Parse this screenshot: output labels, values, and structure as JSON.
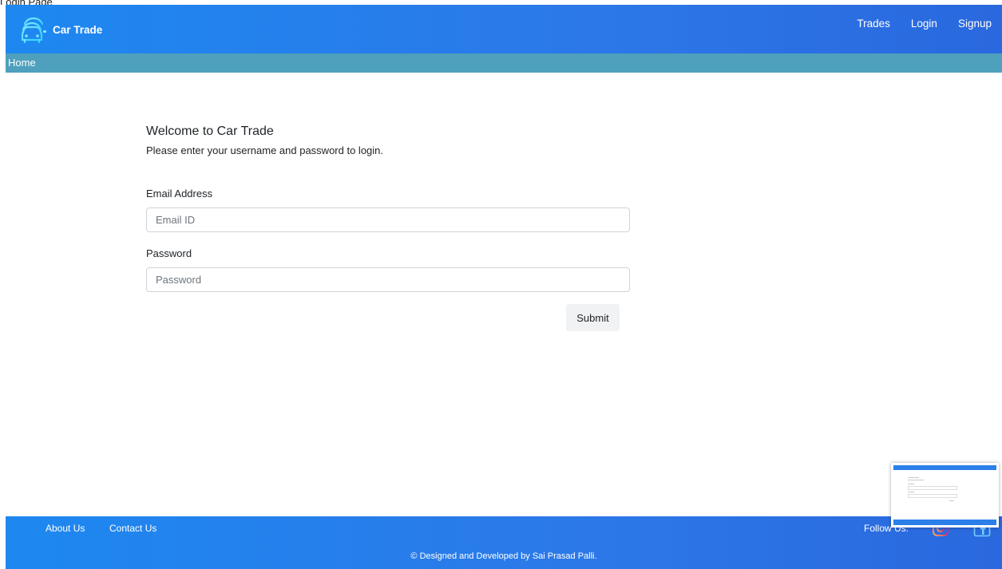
{
  "page_caption": "Login Page",
  "navbar": {
    "brand": "Car Trade",
    "brand_icon": "car-stack-icon",
    "links": [
      "Trades",
      "Login",
      "Signup"
    ]
  },
  "breadcrumb": {
    "home": "Home"
  },
  "login": {
    "title": "Welcome to Car Trade",
    "subtitle": "Please enter your username and password to login.",
    "email_label": "Email Address",
    "email_placeholder": "Email ID",
    "password_label": "Password",
    "password_placeholder": "Password",
    "submit_label": "Submit"
  },
  "footer": {
    "about": "About Us",
    "contact": "Contact Us",
    "follow": "Follow Us:",
    "copyright": "© Designed and Developed by Sai Prasad Palli.",
    "social_icons": [
      "instagram-icon",
      "facebook-icon"
    ]
  },
  "colors": {
    "navbar": "#2a78e8",
    "breadcrumb_bar": "#4ea0bd",
    "footer": "#2a78e8",
    "instagram": "#e1306c",
    "facebook_outline": "#2f6fe0"
  }
}
